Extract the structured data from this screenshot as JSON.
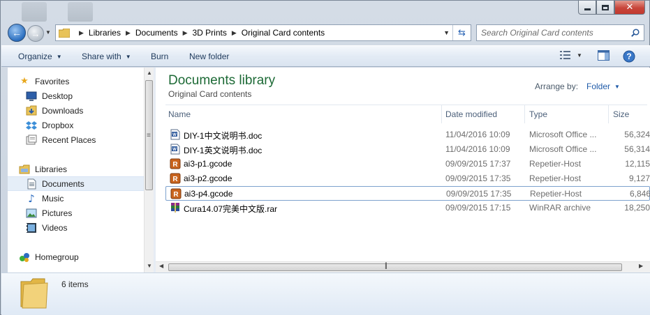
{
  "window": {
    "controls": [
      {
        "name": "minimize-button",
        "icon": "minimize-icon"
      },
      {
        "name": "maximize-button",
        "icon": "maximize-icon"
      },
      {
        "name": "close-button",
        "icon": "close-icon"
      }
    ]
  },
  "address": {
    "breadcrumbs": [
      "Libraries",
      "Documents",
      "3D Prints",
      "Original Card contents"
    ]
  },
  "search": {
    "placeholder": "Search Original Card contents"
  },
  "toolbar": {
    "organize": "Organize",
    "share_with": "Share with",
    "burn": "Burn",
    "new_folder": "New folder"
  },
  "nav": {
    "favorites_label": "Favorites",
    "favorites": [
      "Desktop",
      "Downloads",
      "Dropbox",
      "Recent Places"
    ],
    "libraries_label": "Libraries",
    "libraries": [
      "Documents",
      "Music",
      "Pictures",
      "Videos"
    ],
    "homegroup_label": "Homegroup",
    "selected": "Documents"
  },
  "library": {
    "title": "Documents library",
    "subtitle": "Original Card contents",
    "arrange_label": "Arrange by:",
    "arrange_value": "Folder"
  },
  "columns": {
    "name": "Name",
    "date": "Date modified",
    "type": "Type",
    "size": "Size"
  },
  "files": [
    {
      "name": "DIY-1中文说明书.doc",
      "date": "11/04/2016 10:09",
      "type": "Microsoft Office ...",
      "size": "56,324",
      "icon": "word-doc-icon"
    },
    {
      "name": "DIY-1英文说明书.doc",
      "date": "11/04/2016 10:09",
      "type": "Microsoft Office ...",
      "size": "56,314",
      "icon": "word-doc-icon"
    },
    {
      "name": "ai3-p1.gcode",
      "date": "09/09/2015 17:37",
      "type": "Repetier-Host",
      "size": "12,115",
      "icon": "repetier-icon"
    },
    {
      "name": "ai3-p2.gcode",
      "date": "09/09/2015 17:35",
      "type": "Repetier-Host",
      "size": "9,127",
      "icon": "repetier-icon"
    },
    {
      "name": "ai3-p4.gcode",
      "date": "09/09/2015 17:35",
      "type": "Repetier-Host",
      "size": "6,846",
      "icon": "repetier-icon"
    },
    {
      "name": "Cura14.07完美中文版.rar",
      "date": "09/09/2015 17:15",
      "type": "WinRAR archive",
      "size": "18,250",
      "icon": "winrar-icon"
    }
  ],
  "status": {
    "count": "6 items"
  },
  "colors": {
    "library_title": "#1d6a36",
    "link_blue": "#1e5aa8",
    "selection": "#e5eef8"
  }
}
